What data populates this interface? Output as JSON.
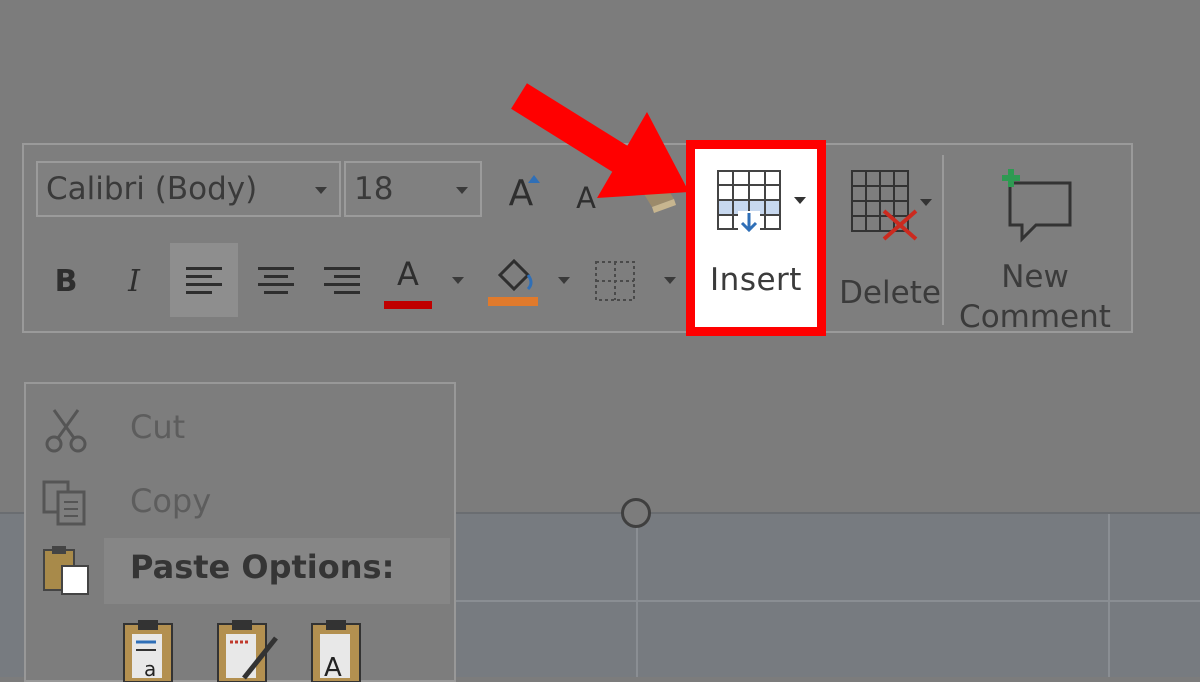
{
  "toolbar": {
    "font_name": "Calibri (Body)",
    "font_size": "18",
    "grow_font_glyph": "A",
    "shrink_font_glyph": "A",
    "bold_glyph": "B",
    "italic_glyph": "I",
    "font_color_glyph": "A",
    "insert_label": "Insert",
    "delete_label": "Delete",
    "new_comment_line1": "New",
    "new_comment_line2": "Comment"
  },
  "context_menu": {
    "cut_label": "Cut",
    "copy_label": "Copy",
    "paste_options_label": "Paste Options:"
  },
  "colors": {
    "highlight_border": "#ff0000",
    "font_color_bar": "#c00000",
    "shading_bar": "#e07a2c",
    "comment_plus": "#2e9a52",
    "delete_x": "#cc2a1f"
  }
}
